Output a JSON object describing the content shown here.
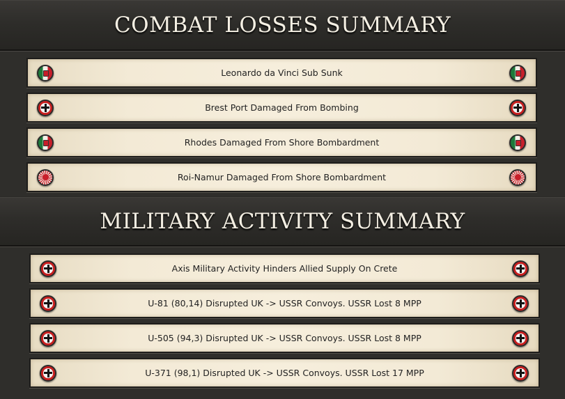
{
  "combat_losses": {
    "title": "COMBAT LOSSES SUMMARY",
    "items": [
      {
        "label": "Leonardo da Vinci Sub Sunk",
        "icon": "italy-flag-icon"
      },
      {
        "label": "Brest Port Damaged From Bombing",
        "icon": "germany-flag-icon"
      },
      {
        "label": "Rhodes Damaged From Shore Bombardment",
        "icon": "italy-flag-icon"
      },
      {
        "label": "Roi-Namur Damaged From Shore Bombardment",
        "icon": "japan-flag-icon"
      }
    ]
  },
  "military_activity": {
    "title": "MILITARY ACTIVITY SUMMARY",
    "items": [
      {
        "label": "Axis Military Activity Hinders Allied Supply On Crete",
        "icon": "germany-flag-icon"
      },
      {
        "label": "U-81 (80,14) Disrupted UK -> USSR Convoys.  USSR Lost 8 MPP",
        "icon": "germany-flag-icon"
      },
      {
        "label": "U-505 (94,3) Disrupted UK -> USSR Convoys.  USSR Lost 8 MPP",
        "icon": "germany-flag-icon"
      },
      {
        "label": "U-371 (98,1) Disrupted UK -> USSR Convoys.  USSR Lost 17 MPP",
        "icon": "germany-flag-icon"
      }
    ]
  },
  "colors": {
    "row_background": "#f6eedc",
    "header_text": "#f4efe3",
    "panel_background": "#2f2e2b"
  }
}
